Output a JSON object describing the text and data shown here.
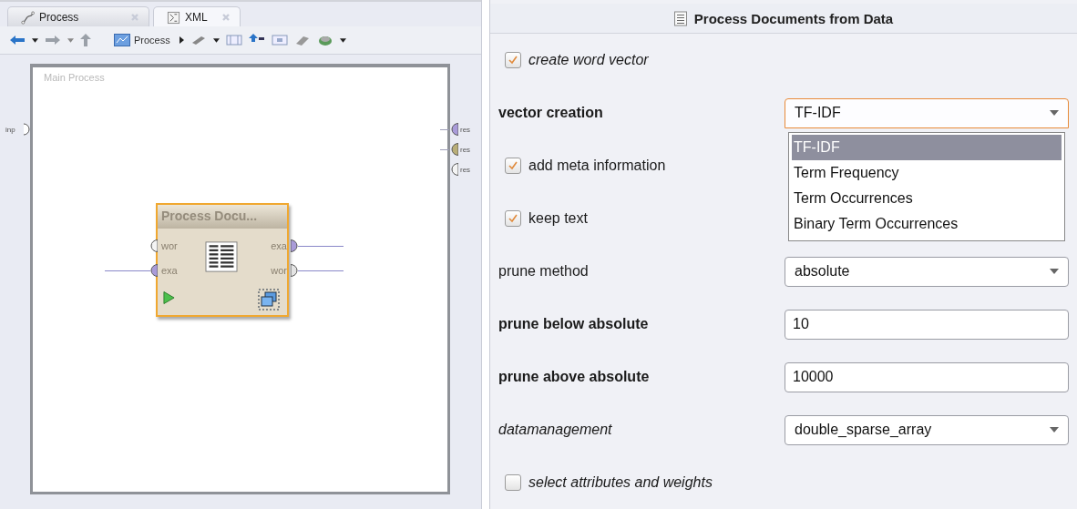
{
  "tabs": [
    {
      "label": "Process",
      "selected": false
    },
    {
      "label": "XML",
      "selected": true
    }
  ],
  "toolbar": {
    "process_button": "Process"
  },
  "canvas": {
    "title": "Main Process",
    "input_ports": [
      {
        "label": "inp",
        "connected": false
      }
    ],
    "output_ports": [
      {
        "label": "res",
        "color": "#a99bd9",
        "connected": true
      },
      {
        "label": "res",
        "color": "#b9ae78",
        "connected": true
      },
      {
        "label": "res",
        "color": "#f4f4f4",
        "connected": false
      }
    ],
    "operator": {
      "title": "Process Docu...",
      "selected": true,
      "inputs": [
        {
          "label": "wor",
          "color": "#f4f4f4",
          "connected": false
        },
        {
          "label": "exa",
          "color": "#a99bd9",
          "connected": true
        }
      ],
      "outputs": [
        {
          "label": "exa",
          "color": "#a99bd9",
          "connected": true
        },
        {
          "label": "wor",
          "color": "#e4e4e4",
          "connected": true
        }
      ]
    }
  },
  "panel": {
    "title": "Process Documents from Data",
    "parameters": [
      {
        "kind": "checkbox",
        "label": "create word vector",
        "required": false,
        "expert": true,
        "checked": true
      },
      {
        "kind": "select",
        "label": "vector creation",
        "required": true,
        "expert": false,
        "value": "TF-IDF",
        "focused": true,
        "expanded": true,
        "options": [
          {
            "label": "TF-IDF",
            "selected": true
          },
          {
            "label": "Term Frequency",
            "selected": false
          },
          {
            "label": "Term Occurrences",
            "selected": false
          },
          {
            "label": "Binary Term Occurrences",
            "selected": false
          }
        ]
      },
      {
        "kind": "checkbox",
        "label": "add meta information",
        "required": false,
        "expert": false,
        "checked": true
      },
      {
        "kind": "checkbox",
        "label": "keep text",
        "required": false,
        "expert": false,
        "checked": true
      },
      {
        "kind": "select",
        "label": "prune method",
        "required": false,
        "expert": false,
        "value": "absolute",
        "focused": false,
        "expanded": false
      },
      {
        "kind": "number",
        "label": "prune below absolute",
        "required": true,
        "expert": false,
        "value": "10"
      },
      {
        "kind": "number",
        "label": "prune above absolute",
        "required": true,
        "expert": false,
        "value": "10000"
      },
      {
        "kind": "select",
        "label": "datamanagement",
        "required": false,
        "expert": true,
        "value": "double_sparse_array",
        "focused": false,
        "expanded": false
      },
      {
        "kind": "checkbox",
        "label": "select attributes and weights",
        "required": false,
        "expert": true,
        "checked": false
      }
    ]
  }
}
